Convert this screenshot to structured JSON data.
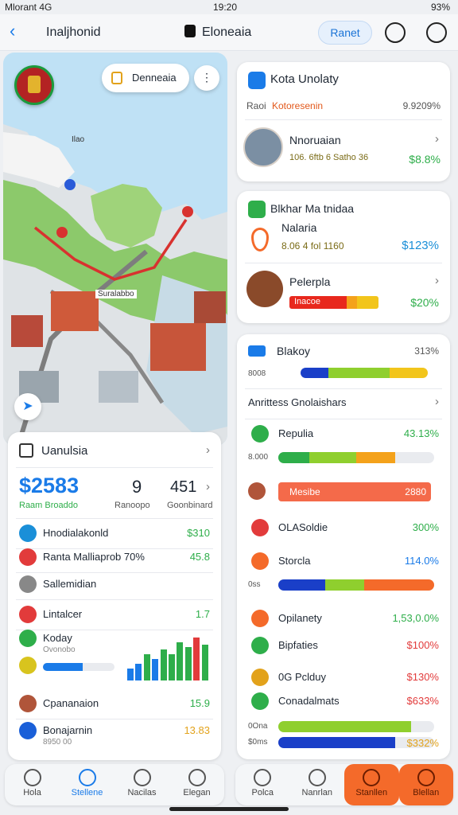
{
  "status": {
    "left": "Mlorant 4G",
    "time": "19:20",
    "right": "93%"
  },
  "nav": {
    "left_title": "Inaljhonid",
    "center_title": "Eloneaia",
    "pill": "Ranet"
  },
  "map": {
    "search_label": "Denneaia",
    "place_label": "Ilao",
    "road_label": "Suralabbo"
  },
  "summary": {
    "title": "Uanulsia",
    "big_value": "$2583",
    "big_label": "Raam Broaddo",
    "stat2_value": "9",
    "stat2_label": "Ranoopo",
    "stat3_value": "451",
    "stat3_label": "Goonbinard",
    "rows": [
      {
        "label": "Hnodialakonld",
        "value": "$310",
        "color": "#1a8fd8"
      },
      {
        "label": "Ranta Malliaprob 70%",
        "value": "45.8",
        "color": "#e23b3b"
      },
      {
        "label": "Sallemidian",
        "value": "",
        "color": "#888888"
      },
      {
        "label": "Lintalcer",
        "value": "1.7",
        "color": "#e23b3b"
      },
      {
        "label": "Koday",
        "sub": "Ovonobo",
        "value": "",
        "color": "#2eae4a"
      },
      {
        "label": "",
        "value": "",
        "color": "#d8c41e"
      },
      {
        "label": "Cpananaion",
        "value": "15.9",
        "color": "#b0553a"
      },
      {
        "label": "Bonajarnin",
        "sub": "8950 00",
        "value": "13.83",
        "color": "#1a5fd8"
      }
    ],
    "mini_bars": [
      0.25,
      0.35,
      0.55,
      0.45,
      0.65,
      0.55,
      0.8,
      0.7,
      0.9,
      0.75
    ]
  },
  "card1": {
    "title": "Kota Unolaty",
    "sub_left": "Raoi",
    "sub_accent": "Kotoresenin",
    "sub_right": "9.9209%",
    "item_title": "Nnoruaian",
    "item_meta": "106. 6ftb 6 Satho 36",
    "item_value": "$8.8%"
  },
  "card2": {
    "title": "Blkhar Ma tnidaa",
    "item1_title": "Nalaria",
    "item1_meta": "8.06 4 fol 1160",
    "item1_value": "$123%",
    "item2_title": "Pelerpla",
    "item2_bar_label": "Inacoe",
    "item2_value": "$20%"
  },
  "card3": {
    "title": "Blakoy",
    "title_value": "313%",
    "bar_label": "8008",
    "section": "Anrittess Gnolaishars",
    "rows": [
      {
        "label": "Repulia",
        "value": "43.13%",
        "color": "#2eae4a"
      },
      {
        "label": "8.000",
        "value": "",
        "color": "#555555"
      },
      {
        "label": "Mesibe",
        "value": "2880",
        "color": "#b0553a"
      },
      {
        "label": "OLASoldie",
        "value": "300%",
        "color": "#e23b3b"
      },
      {
        "label": "Storcla",
        "value": "114.0%",
        "color": "#f46a2a"
      },
      {
        "label": "0ss",
        "value": "",
        "color": "#888888"
      },
      {
        "label": "Opilanety",
        "value": "1,53,0.0%",
        "color": "#f46a2a"
      },
      {
        "label": "Bipfaties",
        "value": "$100%",
        "color": "#2eae4a"
      },
      {
        "label": "0G Pclduy",
        "value": "$130%",
        "color": "#e2a21b"
      },
      {
        "label": "Conadalmats",
        "value": "$633%",
        "color": "#2eae4a"
      },
      {
        "label": "0Ona",
        "value": "",
        "color": "#555555"
      },
      {
        "label": "$0ms",
        "value": "$332%",
        "color": "#555555"
      }
    ]
  },
  "tabs_left": [
    "Hola",
    "Stellene",
    "Nacilas",
    "Elegan"
  ],
  "tabs_right": [
    "Polca",
    "Nanrlan",
    "Stanllen",
    "Blellan"
  ]
}
